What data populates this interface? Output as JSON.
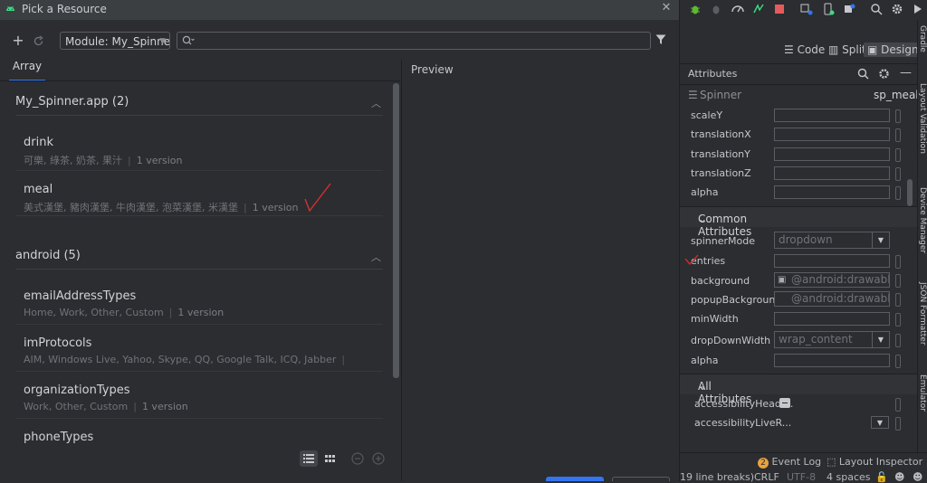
{
  "dialog": {
    "title": "Pick a Resource",
    "module_select": "Module: My_Spinne",
    "tab": "Array",
    "preview_label": "Preview",
    "groups": [
      {
        "header": "My_Spinner.app (2)",
        "items": [
          {
            "name": "drink",
            "values": "可樂, 綠茶, 奶茶, 果汁",
            "version": "1 version"
          },
          {
            "name": "meal",
            "values": "美式漢堡, 豬肉漢堡, 牛肉漢堡, 泡菜漢堡, 米漢堡",
            "version": "1 version"
          }
        ]
      },
      {
        "header": "android (5)",
        "items": [
          {
            "name": "emailAddressTypes",
            "values": "Home, Work, Other, Custom",
            "version": "1 version"
          },
          {
            "name": "imProtocols",
            "values": "AIM, Windows Live, Yahoo, Skype, QQ, Google Talk, ICQ, Jabber",
            "version": ""
          },
          {
            "name": "organizationTypes",
            "values": "Work, Other, Custom",
            "version": "1 version"
          },
          {
            "name": "phoneTypes",
            "values": "",
            "version": ""
          }
        ]
      }
    ]
  },
  "ide": {
    "view_modes": {
      "code": "Code",
      "split": "Split",
      "design": "Design"
    },
    "attributes_title": "Attributes",
    "component": {
      "name": "Spinner",
      "id": "sp_meal"
    },
    "transform_attrs": [
      {
        "label": "scaleY",
        "value": ""
      },
      {
        "label": "translationX",
        "value": ""
      },
      {
        "label": "translationY",
        "value": ""
      },
      {
        "label": "translationZ",
        "value": ""
      },
      {
        "label": "alpha",
        "value": ""
      }
    ],
    "common_header": "Common Attributes",
    "common_attrs": [
      {
        "label": "spinnerMode",
        "value": "dropdown"
      },
      {
        "label": "entries",
        "value": ""
      },
      {
        "label": "background",
        "value": "@android:drawable/"
      },
      {
        "label": "popupBackground",
        "value": "@android:drawable/"
      },
      {
        "label": "minWidth",
        "value": ""
      },
      {
        "label": "dropDownWidth",
        "value": "wrap_content"
      },
      {
        "label": "alpha",
        "value": ""
      }
    ],
    "all_header": "All Attributes",
    "all_attrs": [
      {
        "label": "accessibilityHeadi..."
      },
      {
        "label": "accessibilityLiveR..."
      }
    ],
    "side_tabs": [
      "Gradle",
      "Layout Validation",
      "Device Manager",
      "JSON Formatter",
      "Emulator"
    ],
    "bottom_tools": {
      "event_log": "Event Log",
      "event_log_count": "2",
      "layout_inspector": "Layout Inspector"
    },
    "status": {
      "line_breaks": "19 line breaks)",
      "line_sep": "CRLF",
      "encoding": "UTF-8",
      "indent": "4 spaces"
    }
  },
  "colors": {
    "accent": "#3574f0",
    "check_mark": "#d9302c",
    "bg": "#2b2d30"
  }
}
